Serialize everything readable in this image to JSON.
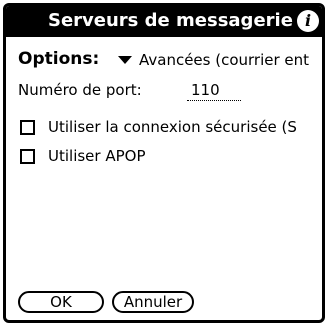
{
  "window": {
    "title": "Serveurs de messagerie",
    "info_icon": "info-icon"
  },
  "options": {
    "label": "Options:",
    "selected": "Avancées (courrier ent",
    "dropdown_icon": "triangle-down-icon"
  },
  "port": {
    "label": "Numéro de port:",
    "value": "110"
  },
  "checkboxes": [
    {
      "label": "Utiliser la connexion sécurisée (S",
      "checked": false
    },
    {
      "label": "Utiliser APOP",
      "checked": false
    }
  ],
  "buttons": {
    "ok": "OK",
    "cancel": "Annuler"
  }
}
